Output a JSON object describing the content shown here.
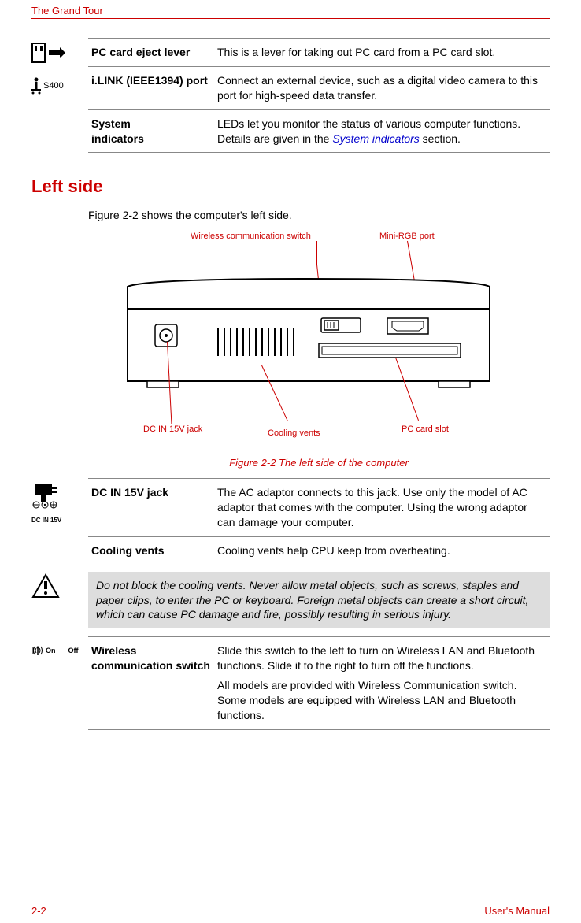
{
  "header": {
    "title": "The Grand Tour"
  },
  "top_table": {
    "rows": [
      {
        "term": "PC card eject lever",
        "desc": "This is a lever for taking out PC card from a PC card slot."
      },
      {
        "term": "i.LINK (IEEE1394) port",
        "desc": "Connect an external device, such as a digital video camera to this port for high-speed data transfer."
      },
      {
        "term": "System indicators",
        "desc_pre": "LEDs let you monitor the status of various computer functions. Details are given in the ",
        "desc_link": "System indicators",
        "desc_post": " section."
      }
    ],
    "s400_label": "S400"
  },
  "section_heading": "Left side",
  "intro_text": "Figure 2-2 shows the computer's left side.",
  "figure": {
    "callouts": {
      "wireless": "Wireless communication switch",
      "mini_rgb": "Mini-RGB port",
      "dc_in": "DC IN 15V jack",
      "cooling": "Cooling vents",
      "pc_card": "PC card slot"
    },
    "caption": "Figure 2-2 The left side of the computer"
  },
  "bottom_table1": {
    "rows": [
      {
        "term": "DC IN 15V jack",
        "desc": "The AC adaptor connects to this jack. Use only the model of AC adaptor that comes with the computer. Using the wrong adaptor can damage your computer."
      },
      {
        "term": "Cooling vents",
        "desc": "Cooling vents help CPU keep from overheating."
      }
    ],
    "dc_in_label": "DC IN 15V"
  },
  "warning_text": "Do not block the cooling vents. Never allow metal objects, such as screws, staples and paper clips, to enter the PC or keyboard. Foreign metal objects can create a short circuit, which can cause PC damage and fire, possibly resulting in serious injury.",
  "bottom_table2": {
    "rows": [
      {
        "term": "Wireless communication switch",
        "desc": "Slide this switch to the left to turn on Wireless LAN and Bluetooth functions. Slide it to the right to turn off the  functions.",
        "desc2": "All models are provided with Wireless Communication switch. Some models are equipped with Wireless LAN and Bluetooth functions."
      }
    ],
    "on_label": "On",
    "off_label": "Off"
  },
  "footer": {
    "page": "2-2",
    "manual": "User's Manual"
  }
}
